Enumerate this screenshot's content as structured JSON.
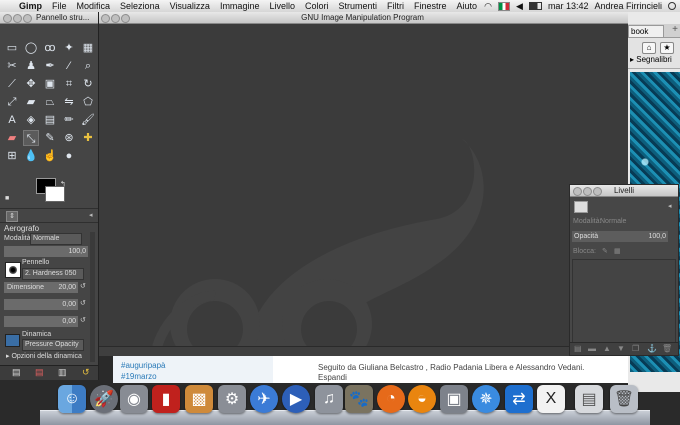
{
  "menubar": {
    "apple": "",
    "app": "Gimp",
    "items": [
      "File",
      "Modifica",
      "Seleziona",
      "Visualizza",
      "Immagine",
      "Livello",
      "Colori",
      "Strumenti",
      "Filtri",
      "Finestre",
      "Aiuto"
    ],
    "clock": "mar 13:42",
    "user": "Andrea Firrincieli",
    "flag_colors": [
      "#009246",
      "#ffffff",
      "#ce2b37"
    ]
  },
  "browser": {
    "tab_label": "book",
    "new_tab": "+",
    "home_icon": "home-icon",
    "star_icon": "star-icon",
    "bookmarks": "Segnalibri"
  },
  "webpage": {
    "hashtags": [
      "#auguripapà",
      "#19marzo"
    ],
    "text1": "Seguito da Giuliana Belcastro , Radio Padania Libera e Alessandro Vedani.",
    "text2": "Espandi"
  },
  "gimp_main": {
    "title": "GNU Image Manipulation Program"
  },
  "toolbox": {
    "title": "Pannello stru...",
    "section": "Aerografo",
    "mode_label": "Modalità:",
    "mode_value": "Normale",
    "opacity_value": "100,0",
    "brush_label": "Pennello",
    "brush_value": "2. Hardness 050",
    "size_label": "Dimensione",
    "size_value": "20,00",
    "aspect_value": "0,00",
    "angle_value": "0,00",
    "dynamics_label": "Dinamica",
    "dynamics_value": "Pressure Opacity",
    "dynamics_options": "Opzioni della dinamica",
    "fg_color": "#000000",
    "bg_color": "#ffffff",
    "selected_tool": "airbrush-tool"
  },
  "layers": {
    "title": "Livelli",
    "mode_label": "Modalità:",
    "mode_value": "Normale",
    "opacity_label": "Opacità",
    "opacity_value": "100,0",
    "lock_label": "Blocca:"
  },
  "dock": {
    "apps": [
      "finder",
      "launchpad",
      "facetime",
      "photo-booth",
      "iphoto",
      "system-preferences",
      "preview",
      "quicktime",
      "itunes",
      "gimp",
      "firefox",
      "blender",
      "image-capture",
      "safari",
      "teamviewer",
      "x11",
      "documents",
      "trash"
    ]
  }
}
